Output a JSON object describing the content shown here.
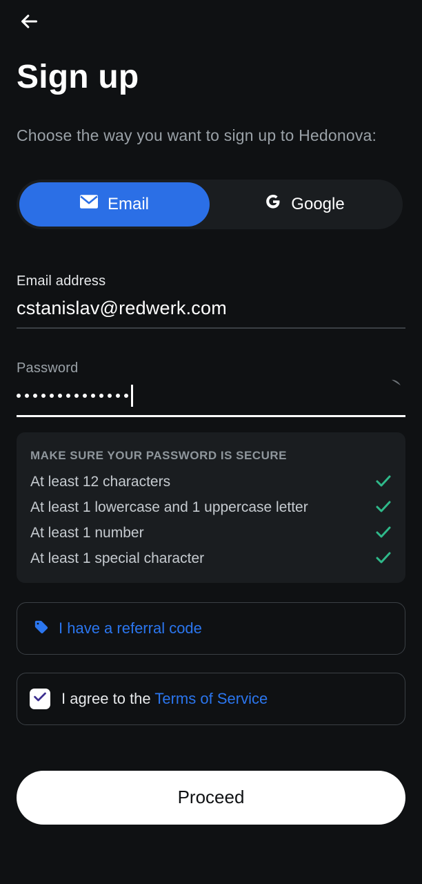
{
  "header": {
    "title": "Sign up",
    "subtitle": "Choose the way you want to sign up to Hedonova:"
  },
  "segmented": {
    "email_label": "Email",
    "google_label": "Google",
    "active": "email"
  },
  "email_field": {
    "label": "Email address",
    "value": "cstanislav@redwerk.com"
  },
  "password_field": {
    "label": "Password",
    "masked_length": 14,
    "visible": false
  },
  "password_rules": {
    "title": "MAKE SURE YOUR PASSWORD IS SECURE",
    "items": [
      {
        "text": "At least 12 characters",
        "ok": true
      },
      {
        "text": "At least 1 lowercase and 1 uppercase letter",
        "ok": true
      },
      {
        "text": "At least 1 number",
        "ok": true
      },
      {
        "text": "At least 1 special character",
        "ok": true
      }
    ]
  },
  "referral": {
    "label": "I have a referral code"
  },
  "agree": {
    "checked": true,
    "prefix": "I agree to the ",
    "link_label": "Terms of Service"
  },
  "proceed_label": "Proceed",
  "colors": {
    "accent": "#2b6fe6",
    "link": "#2b76ef",
    "check": "#2fb98a"
  }
}
